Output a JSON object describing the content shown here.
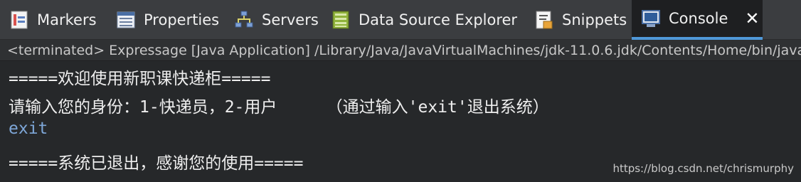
{
  "tabs": [
    {
      "label": "Markers",
      "icon": "markers-icon",
      "active": false
    },
    {
      "label": "Properties",
      "icon": "properties-icon",
      "active": false
    },
    {
      "label": "Servers",
      "icon": "servers-icon",
      "active": false
    },
    {
      "label": "Data Source Explorer",
      "icon": "data-source-explorer-icon",
      "active": false
    },
    {
      "label": "Snippets",
      "icon": "snippets-icon",
      "active": false
    },
    {
      "label": "Console",
      "icon": "console-icon",
      "active": true
    }
  ],
  "status": "<terminated> Expressage [Java Application] /Library/Java/JavaVirtualMachines/jdk-11.0.6.jdk/Contents/Home/bin/java",
  "console_lines": [
    {
      "text": "=====欢迎使用新职课快递柜=====",
      "type": "output"
    },
    {
      "text": "请输入您的身份：1-快递员，2-用户     （通过输入'exit'退出系统）",
      "type": "output"
    },
    {
      "text": "exit",
      "type": "input"
    },
    {
      "text": "=====系统已退出，感谢您的使用=====",
      "type": "output"
    }
  ],
  "watermark": "https://blog.csdn.net/chrismurphy",
  "colors": {
    "accent": "#4f98d8",
    "input_text": "#7ea7d8",
    "background": "#26282a"
  }
}
